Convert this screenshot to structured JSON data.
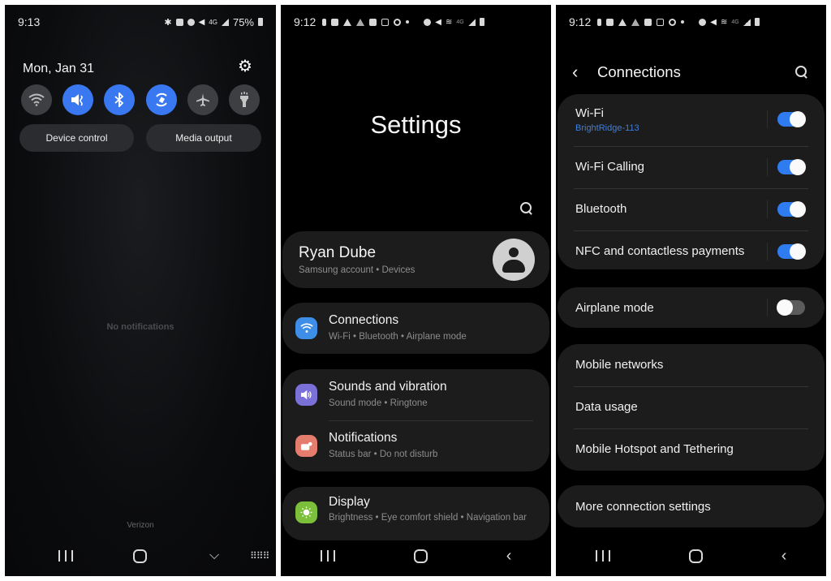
{
  "quick_panel": {
    "status": {
      "time": "9:13",
      "battery": "75%"
    },
    "date": "Mon, Jan 31",
    "tiles": [
      {
        "name": "wifi",
        "icon": "wifi-icon",
        "state": "off"
      },
      {
        "name": "mute",
        "icon": "mute-icon",
        "state": "on"
      },
      {
        "name": "bluetooth",
        "icon": "bluetooth-icon",
        "state": "on"
      },
      {
        "name": "auto-rotate",
        "icon": "rotate-icon",
        "state": "on"
      },
      {
        "name": "airplane",
        "icon": "airplane-icon",
        "state": "off"
      },
      {
        "name": "flashlight",
        "icon": "flashlight-icon",
        "state": "off"
      }
    ],
    "device_control_label": "Device control",
    "media_output_label": "Media output",
    "no_notifications": "No notifications",
    "carrier": "Verizon"
  },
  "settings": {
    "status": {
      "time": "9:12"
    },
    "title": "Settings",
    "account": {
      "name": "Ryan Dube",
      "subtitle": "Samsung account  •  Devices"
    },
    "items": [
      {
        "title": "Connections",
        "subtitle": "Wi-Fi  •  Bluetooth  •  Airplane mode",
        "icon": "wifi-icon",
        "color": "#3e8ee8"
      },
      {
        "title": "Sounds and vibration",
        "subtitle": "Sound mode  •  Ringtone",
        "icon": "volume-icon",
        "color": "#7b6fd8"
      },
      {
        "title": "Notifications",
        "subtitle": "Status bar  •  Do not disturb",
        "icon": "notification-icon",
        "color": "#e57d6e"
      },
      {
        "title": "Display",
        "subtitle": "Brightness  •  Eye comfort shield  •  Navigation bar",
        "icon": "brightness-icon",
        "color": "#7cbf3a"
      }
    ]
  },
  "connections": {
    "status": {
      "time": "9:12"
    },
    "title": "Connections",
    "toggles": [
      {
        "label": "Wi-Fi",
        "subtitle": "BrightRidge-113",
        "on": true
      },
      {
        "label": "Wi-Fi Calling",
        "on": true
      },
      {
        "label": "Bluetooth",
        "on": true
      },
      {
        "label": "NFC and contactless payments",
        "on": true
      }
    ],
    "airplane": {
      "label": "Airplane mode",
      "on": false
    },
    "links": [
      "Mobile networks",
      "Data usage",
      "Mobile Hotspot and Tethering"
    ],
    "more": "More connection settings",
    "accent_color": "#2f7cf0"
  }
}
